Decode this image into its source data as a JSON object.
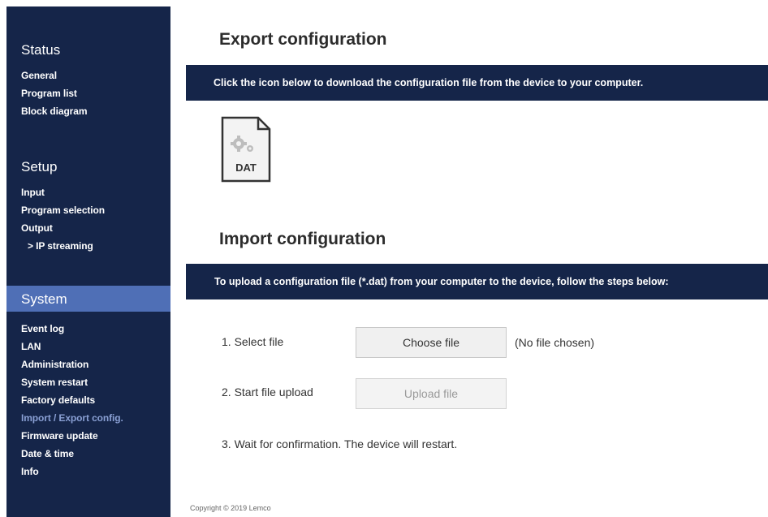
{
  "sidebar": {
    "status_title": "Status",
    "status_items": [
      "General",
      "Program list",
      "Block diagram"
    ],
    "setup_title": "Setup",
    "setup_items": [
      "Input",
      "Program selection",
      "Output",
      "> IP streaming"
    ],
    "system_title": "System",
    "system_items": [
      "Event log",
      "LAN",
      "Administration",
      "System restart",
      "Factory defaults",
      "Import / Export config.",
      "Firmware update",
      "Date & time",
      "Info"
    ],
    "active_item": "Import / Export config."
  },
  "export": {
    "heading": "Export configuration",
    "banner": "Click the icon below to download the configuration file from the device to your computer.",
    "icon_label": "DAT"
  },
  "import": {
    "heading": "Import configuration",
    "banner": "To upload a configuration file (*.dat) from your computer to the device, follow the steps below:",
    "step1": "1. Select file",
    "choose_button": "Choose file",
    "no_file": "(No file chosen)",
    "step2": "2. Start file upload",
    "upload_button": "Upload file",
    "step3": "3. Wait for confirmation. The device will restart."
  },
  "footer": {
    "copyright": "Copyright © 2019 Lemco"
  },
  "colors": {
    "nav_bg": "#152549",
    "system_band": "#4f6fb6",
    "active_link": "#8aa0d4"
  }
}
